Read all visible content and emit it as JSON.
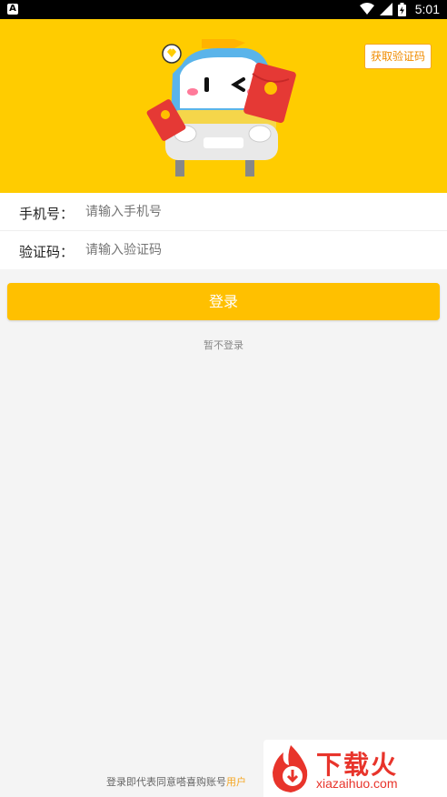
{
  "status_bar": {
    "time": "5:01",
    "app_badge": "A"
  },
  "form": {
    "phone_label": "手机号：",
    "phone_placeholder": "请输入手机号",
    "code_label": "验证码：",
    "code_placeholder": "请输入验证码",
    "get_code_label": "获取验证码"
  },
  "login_button": "登录",
  "skip_login": "暂不登录",
  "terms": {
    "prefix": "登录即代表同意嗒喜购账号",
    "link": "用户"
  },
  "watermark": {
    "title": "下载火",
    "subtitle": "xiazaihuo.com"
  },
  "colors": {
    "hero_bg": "#ffcc00",
    "accent": "#ffc000",
    "link": "#f5a623"
  }
}
